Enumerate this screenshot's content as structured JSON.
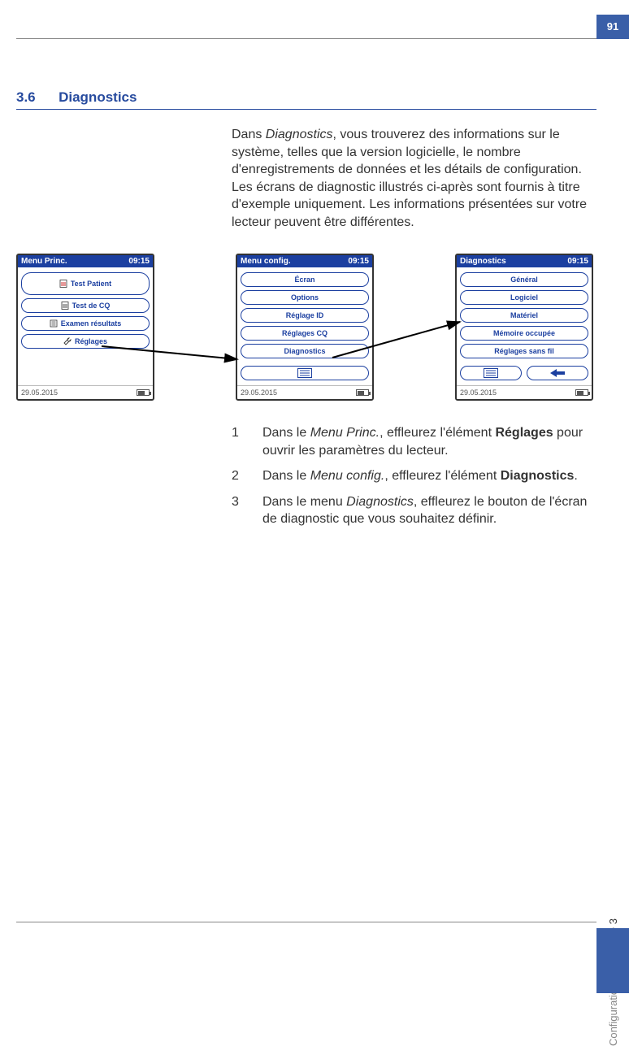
{
  "page_number": "91",
  "section": {
    "number": "3.6",
    "title": "Diagnostics"
  },
  "intro_html": "Dans <em>Diagnostics</em>, vous trouverez des informations sur le système, telles que la version logicielle, le nombre d'enregistrements de données et les détails de configuration. Les écrans de diagnostic illustrés ci-après sont fournis à titre d'exemple uniquement. Les informations présentées sur votre lecteur peuvent être différentes.",
  "screens": [
    {
      "title": "Menu Princ.",
      "time": "09:15",
      "date": "29.05.2015",
      "items": [
        "Test Patient",
        "Test de CQ",
        "Examen résultats",
        "Réglages"
      ],
      "layout": "main"
    },
    {
      "title": "Menu config.",
      "time": "09:15",
      "date": "29.05.2015",
      "items": [
        "Écran",
        "Options",
        "Réglage ID",
        "Réglages CQ",
        "Diagnostics"
      ],
      "layout": "config"
    },
    {
      "title": "Diagnostics",
      "time": "09:15",
      "date": "29.05.2015",
      "items": [
        "Général",
        "Logiciel",
        "Matériel",
        "Mémoire occupée",
        "Réglages sans fil"
      ],
      "layout": "diag"
    }
  ],
  "steps": [
    {
      "n": "1",
      "html": "Dans le <em>Menu Princ.</em>, effleurez l'élément <strong>Réglages</strong> pour ouvrir les paramètres du lecteur."
    },
    {
      "n": "2",
      "html": "Dans le <em>Menu config.</em>, effleurez l'élément <strong>Diagnostics</strong>."
    },
    {
      "n": "3",
      "html": "Dans le menu <em>Diagnostics</em>, effleurez le bouton de l'écran de diagnostic que vous souhaitez définir."
    }
  ],
  "side_label": {
    "gray": "Configuration du lecteur",
    "sep": " • ",
    "black": "3"
  }
}
